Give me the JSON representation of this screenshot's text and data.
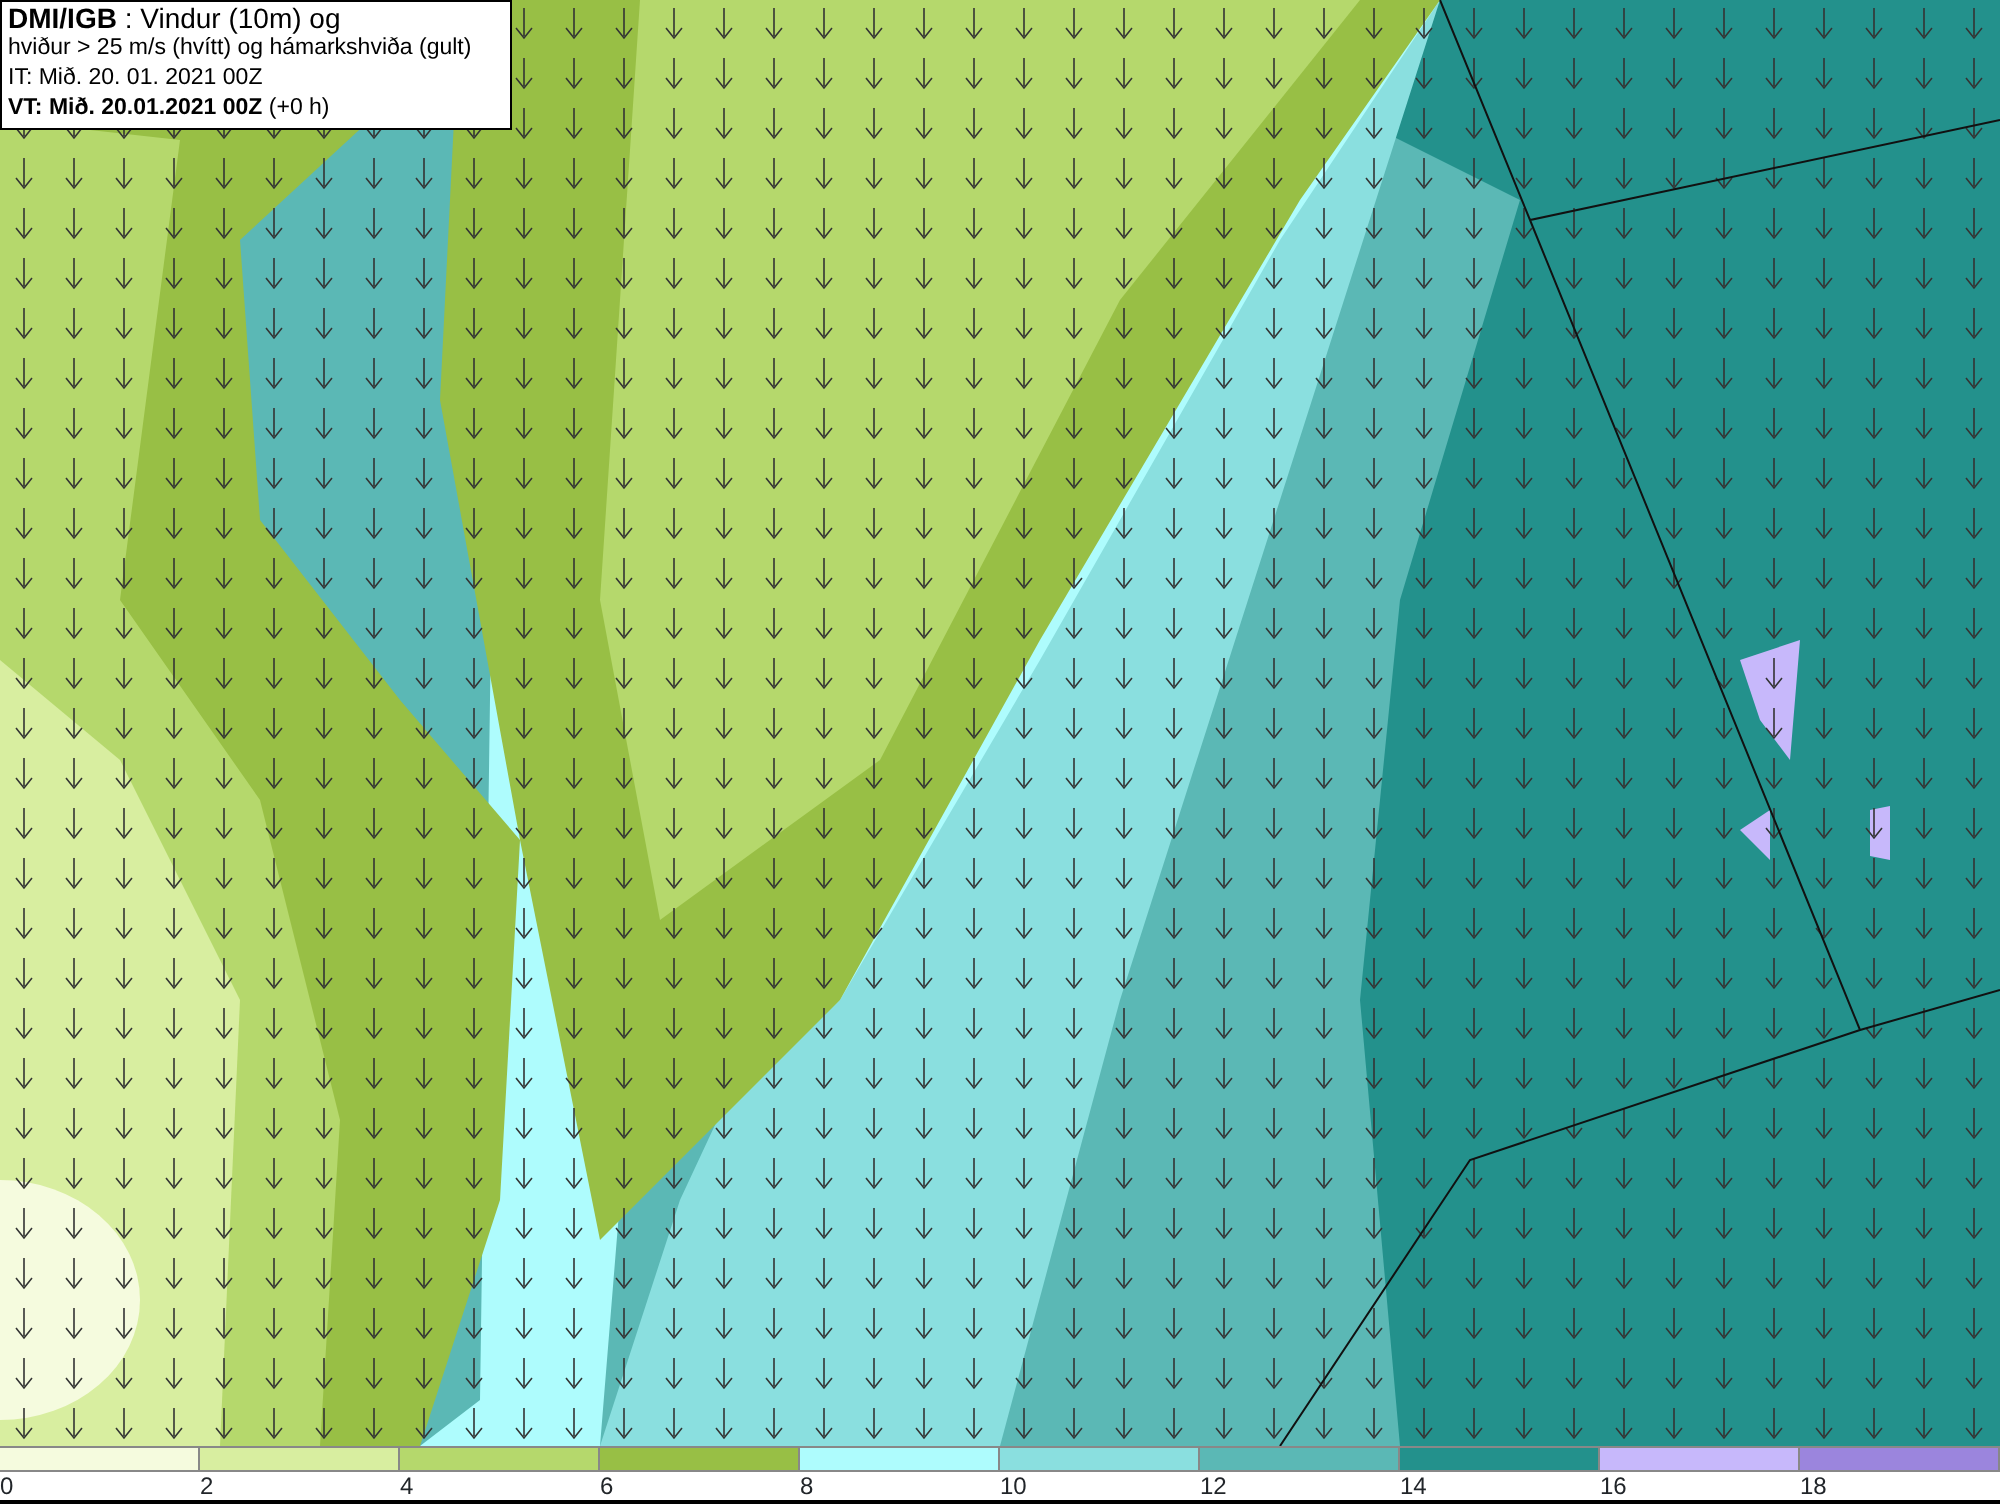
{
  "legend": {
    "lines": [
      "**DMI/IGB** : Vindur (10m) og",
      "hviður > 25 m/s (hvítt) og hámarkshviða (gult)",
      "IT: Mið. 20. 01. 2021 00Z",
      "**VT: Mið. 20.01.2021 00Z** (+0 h)"
    ]
  },
  "color_bar": {
    "segments": [
      {
        "color": "#f5fbde"
      },
      {
        "color": "#d8eea0"
      },
      {
        "color": "#b5d86c"
      },
      {
        "color": "#98bf45"
      },
      {
        "color": "#aefcfd"
      },
      {
        "color": "#8adfdf"
      },
      {
        "color": "#5bb8b5"
      },
      {
        "color": "#23918c"
      },
      {
        "color": "#c7b8fb"
      },
      {
        "color": "#9b85dd"
      }
    ],
    "ticks": [
      "0",
      "2",
      "4",
      "6",
      "8",
      "10",
      "12",
      "14",
      "16",
      "18"
    ]
  }
}
